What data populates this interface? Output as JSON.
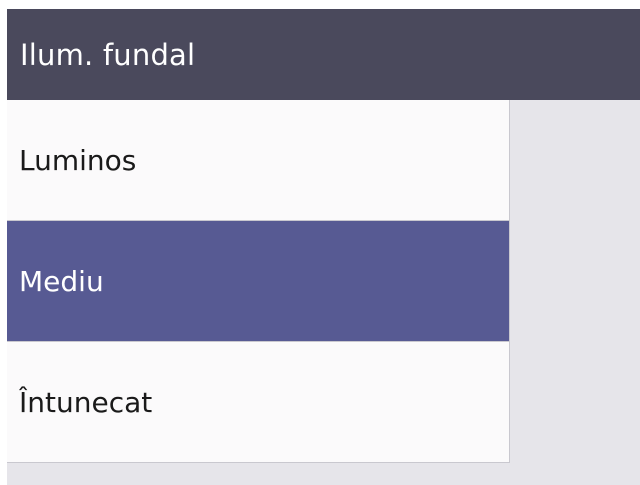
{
  "header": {
    "title": "Ilum. fundal"
  },
  "menu": {
    "items": [
      {
        "label": "Luminos",
        "selected": false
      },
      {
        "label": "Mediu",
        "selected": true
      },
      {
        "label": "Întunecat",
        "selected": false
      }
    ]
  },
  "colors": {
    "header_bg": "#4a495c",
    "selected_bg": "#575a93",
    "list_bg": "#fbfafb",
    "screen_bg": "#e6e5ea"
  }
}
